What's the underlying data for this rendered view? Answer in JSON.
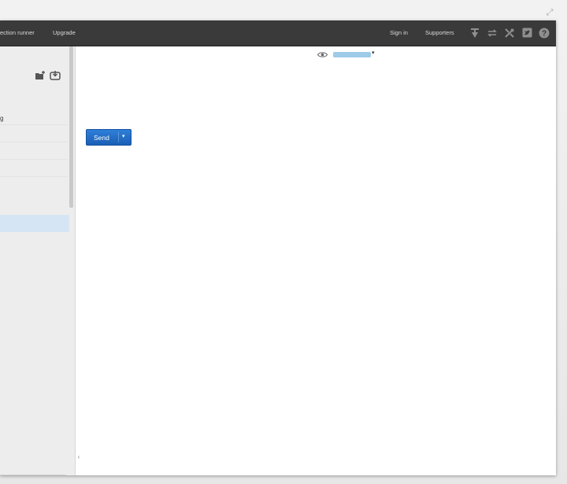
{
  "topbar": {
    "collection_runner_label": "ection runner",
    "upgrade_label": "Upgrade",
    "sign_in_label": "Sign in",
    "supporters_label": "Supporters"
  },
  "sidebar": {
    "item_text": "g"
  },
  "main": {
    "send_label": "Send"
  },
  "icons": {
    "expand": "expand-icon",
    "interceptor": "interceptor-icon",
    "sync": "sync-icon",
    "settings": "settings-icon",
    "twitter": "twitter-icon",
    "help": "help-icon",
    "new_collection": "new-collection-icon",
    "import": "import-icon",
    "eye": "eye-icon"
  },
  "colors": {
    "topbar_bg": "#3a3a3a",
    "send_button": "#1f6ac3",
    "selection": "#d6e5f3"
  }
}
